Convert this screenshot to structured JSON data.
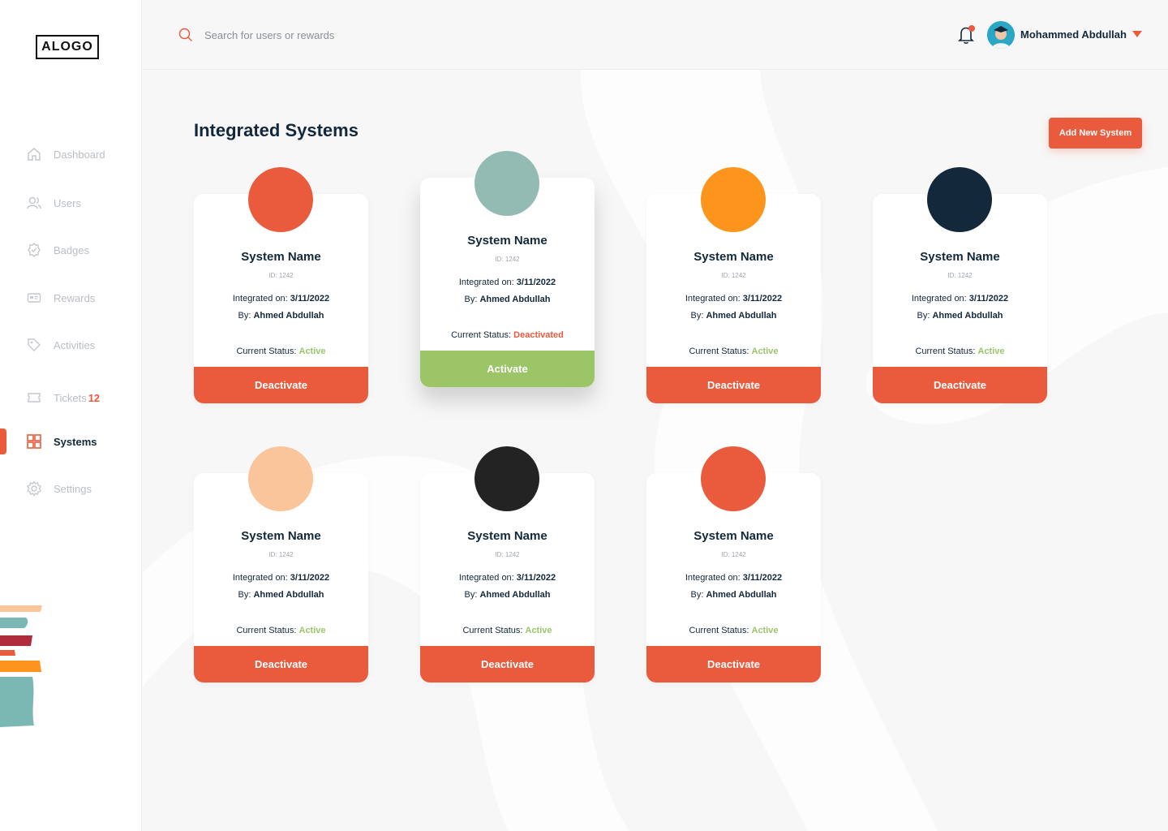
{
  "brand": {
    "logo": "ALOGO"
  },
  "header": {
    "search_placeholder": "Search for users or rewards",
    "user_name": "Mohammed Abdullah",
    "notification_dot_color": "#ea5a3d"
  },
  "sidebar": {
    "items": [
      {
        "label": "Dashboard",
        "icon": "home-icon"
      },
      {
        "label": "Users",
        "icon": "users-icon"
      },
      {
        "label": "Badges",
        "icon": "badge-icon"
      },
      {
        "label": "Rewards",
        "icon": "rewards-icon"
      },
      {
        "label": "Activities",
        "icon": "tag-icon"
      },
      {
        "label": "Tickets",
        "icon": "ticket-icon",
        "count": "12"
      },
      {
        "label": "Systems",
        "icon": "grid-icon",
        "active": true
      },
      {
        "label": "Settings",
        "icon": "gear-icon"
      }
    ]
  },
  "main": {
    "title": "Integrated Systems",
    "add_button": "Add New System",
    "integrated_on_label": "Integrated on:",
    "by_label": "By:",
    "status_label": "Current Status:",
    "cards": [
      {
        "name": "System Name",
        "id": "ID: 1242",
        "date": "3/11/2022",
        "by": "Ahmed Abdullah",
        "status": "Active",
        "action": "Deactivate",
        "color": "#ea5a3d"
      },
      {
        "name": "System Name",
        "id": "ID: 1242",
        "date": "3/11/2022",
        "by": "Ahmed Abdullah",
        "status": "Deactivated",
        "action": "Activate",
        "color": "#93bab3"
      },
      {
        "name": "System Name",
        "id": "ID: 1242",
        "date": "3/11/2022",
        "by": "Ahmed Abdullah",
        "status": "Active",
        "action": "Deactivate",
        "color": "#fd951d"
      },
      {
        "name": "System Name",
        "id": "ID: 1242",
        "date": "3/11/2022",
        "by": "Ahmed Abdullah",
        "status": "Active",
        "action": "Deactivate",
        "color": "#13283a"
      },
      {
        "name": "System Name",
        "id": "ID: 1242",
        "date": "3/11/2022",
        "by": "Ahmed Abdullah",
        "status": "Active",
        "action": "Deactivate",
        "color": "#fbc59b"
      },
      {
        "name": "System Name",
        "id": "ID: 1242",
        "date": "3/11/2022",
        "by": "Ahmed Abdullah",
        "status": "Active",
        "action": "Deactivate",
        "color": "#232323"
      },
      {
        "name": "System Name",
        "id": "ID: 1242",
        "date": "3/11/2022",
        "by": "Ahmed Abdullah",
        "status": "Active",
        "action": "Deactivate",
        "color": "#ea5a3d"
      }
    ]
  }
}
